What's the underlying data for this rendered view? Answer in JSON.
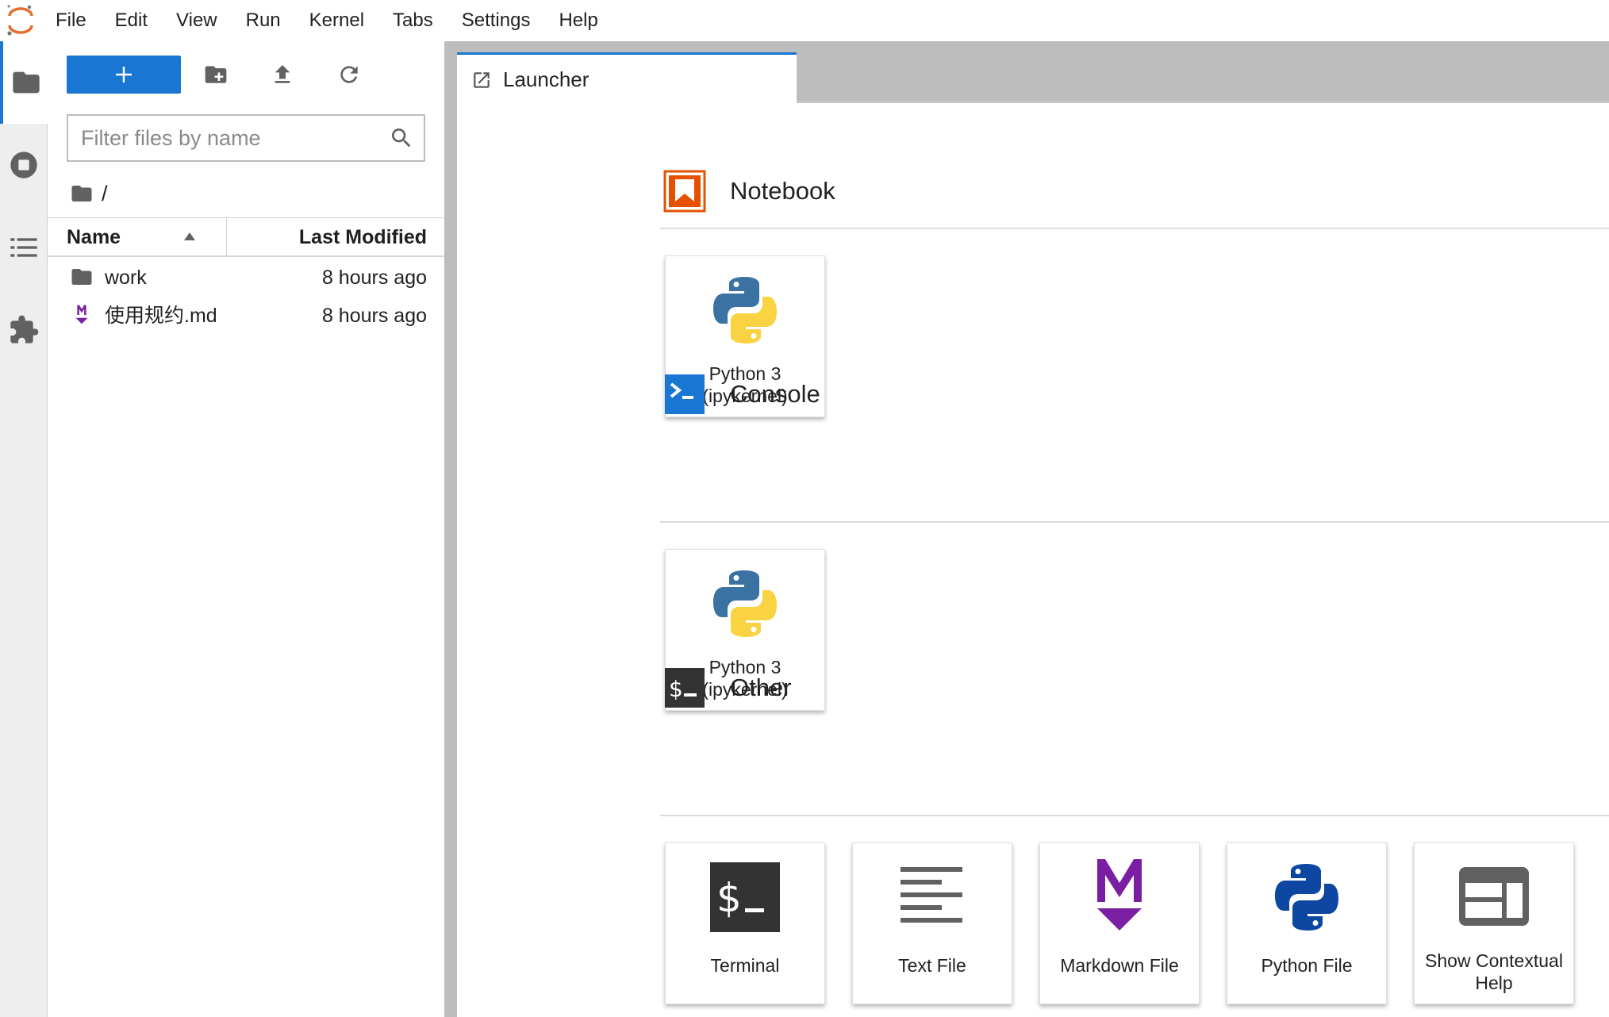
{
  "menubar": {
    "items": [
      "File",
      "Edit",
      "View",
      "Run",
      "Kernel",
      "Tabs",
      "Settings",
      "Help"
    ]
  },
  "colors": {
    "accent": "#1976d2",
    "notebook_orange": "#e65100",
    "markdown_purple": "#7b1fa2",
    "console_blue": "#1976d2",
    "terminal_dark": "#333333"
  },
  "filebrowser": {
    "filter_placeholder": "Filter files by name",
    "breadcrumb": "/",
    "columns": {
      "name": "Name",
      "last_modified": "Last Modified"
    },
    "files": [
      {
        "name": "work",
        "modified": "8 hours ago",
        "icon": "folder-icon"
      },
      {
        "name": "使用规约.md",
        "modified": "8 hours ago",
        "icon": "markdown-file-icon"
      }
    ]
  },
  "tabs": [
    {
      "label": "Launcher",
      "icon": "launcher-icon",
      "active": true
    }
  ],
  "launcher": {
    "sections": [
      {
        "title": "Notebook",
        "icon": "notebook-icon",
        "cards": [
          {
            "label_line1": "Python 3",
            "label_line2": "(ipykernel)",
            "icon": "python-logo-icon"
          }
        ]
      },
      {
        "title": "Console",
        "icon": "console-icon",
        "cards": [
          {
            "label_line1": "Python 3",
            "label_line2": "(ipykernel)",
            "icon": "python-logo-icon"
          }
        ]
      },
      {
        "title": "Other",
        "icon": "terminal-icon",
        "cards": [
          {
            "label_line1": "Terminal",
            "label_line2": "",
            "icon": "terminal-icon"
          },
          {
            "label_line1": "Text File",
            "label_line2": "",
            "icon": "text-file-icon"
          },
          {
            "label_line1": "Markdown File",
            "label_line2": "",
            "icon": "markdown-icon"
          },
          {
            "label_line1": "Python File",
            "label_line2": "",
            "icon": "python-file-icon"
          },
          {
            "label_line1": "Show Contextual",
            "label_line2": "Help",
            "icon": "contextual-help-icon"
          }
        ]
      }
    ]
  }
}
